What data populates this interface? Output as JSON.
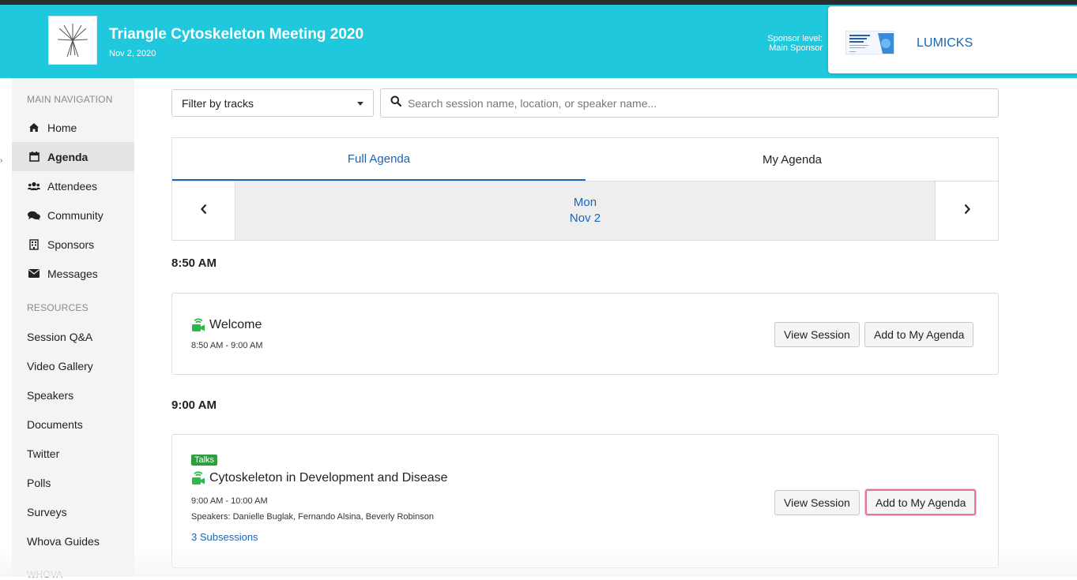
{
  "header": {
    "title": "Triangle Cytoskeleton Meeting 2020",
    "date": "Nov 2, 2020",
    "sponsor_level_line1": "Sponsor level:",
    "sponsor_level_line2": "Main Sponsor",
    "sponsor_name": "LUMICKS",
    "bg_color": "#1fc8dc"
  },
  "sidebar": {
    "main_heading": "MAIN NAVIGATION",
    "items": [
      {
        "label": "Home",
        "icon": "home-icon"
      },
      {
        "label": "Agenda",
        "icon": "calendar-icon",
        "active": true
      },
      {
        "label": "Attendees",
        "icon": "users-icon"
      },
      {
        "label": "Community",
        "icon": "comments-icon"
      },
      {
        "label": "Sponsors",
        "icon": "building-icon"
      },
      {
        "label": "Messages",
        "icon": "envelope-icon"
      }
    ],
    "resources_heading": "RESOURCES",
    "resources": [
      "Session Q&A",
      "Video Gallery",
      "Speakers",
      "Documents",
      "Twitter",
      "Polls",
      "Surveys",
      "Whova Guides"
    ],
    "bottom_heading": "WHOVA"
  },
  "filters": {
    "track_select": "Filter by tracks",
    "search_placeholder": "Search session name, location, or speaker name..."
  },
  "tabs": {
    "full": "Full Agenda",
    "mine": "My Agenda"
  },
  "day": {
    "weekday": "Mon",
    "date": "Nov 2"
  },
  "agenda": [
    {
      "time_heading": "8:50 AM",
      "title": "Welcome",
      "time": "8:50 AM - 9:00 AM",
      "view_label": "View Session",
      "add_label": "Add to My Agenda"
    },
    {
      "time_heading": "9:00 AM",
      "tag": "Talks",
      "title": "Cytoskeleton in Development and Disease",
      "time": "9:00 AM - 10:00 AM",
      "speakers": "Speakers: Danielle Buglak, Fernando Alsina, Beverly Robinson",
      "subsessions": "3 Subsessions",
      "view_label": "View Session",
      "add_label": "Add to My Agenda"
    }
  ],
  "colors": {
    "accent": "#1a66b5",
    "live_green": "#2fb84a",
    "tag_green": "#2e9e3f"
  }
}
